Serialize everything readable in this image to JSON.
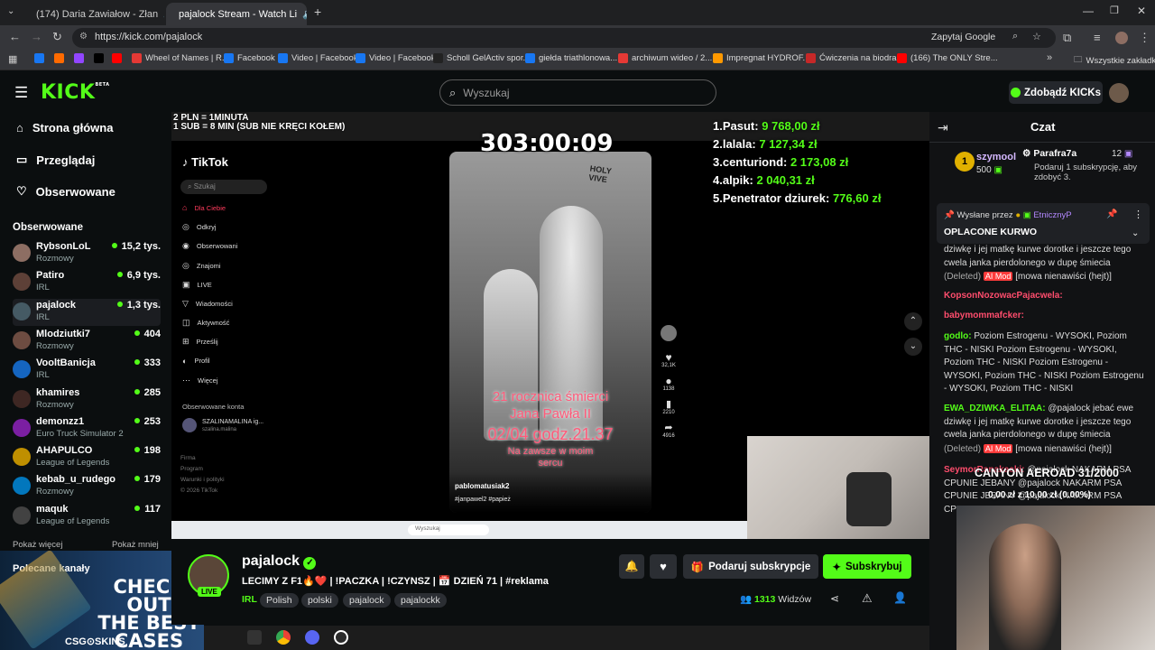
{
  "browser": {
    "tabs": [
      {
        "title": "(174) Daria Zawiałow - Złan",
        "fav_color": "#ff0000"
      },
      {
        "title": "pajalock Stream - Watch Li",
        "fav_color": "#53fc18"
      }
    ],
    "url": "https://kick.com/pajalock",
    "zapytaj": "Zapytaj Google",
    "bookmarks": [
      {
        "label": "",
        "color": "#1877f2"
      },
      {
        "label": "",
        "color": "#ff6a00"
      },
      {
        "label": "",
        "color": "#9146ff"
      },
      {
        "label": "",
        "color": "#000000"
      },
      {
        "label": "",
        "color": "#ff0000"
      },
      {
        "label": "Wheel of Names | R...",
        "color": "#e53935"
      },
      {
        "label": "Facebook",
        "color": "#1877f2"
      },
      {
        "label": "Video | Facebook",
        "color": "#1877f2"
      },
      {
        "label": "Video | Facebook",
        "color": "#1877f2"
      },
      {
        "label": "Scholl GelActiv spor...",
        "color": "#222222"
      },
      {
        "label": "giełda triathlonowa...",
        "color": "#1877f2"
      },
      {
        "label": "archiwum wideo / 2...",
        "color": "#e53935"
      },
      {
        "label": "Impregnat HYDROF...",
        "color": "#ff9900"
      },
      {
        "label": "Ćwiczenia na biodra...",
        "color": "#c62828"
      },
      {
        "label": "(166) The ONLY Stre...",
        "color": "#ff0000"
      }
    ],
    "all_bookmarks": "Wszystkie zakładki"
  },
  "kick": {
    "logo": "KICK",
    "beta": "BETA",
    "search_placeholder": "Wyszukaj",
    "get_kicks": "Zdobądź KICKs",
    "nav": [
      {
        "label": "Strona główna",
        "icon": "home-icon"
      },
      {
        "label": "Przeglądaj",
        "icon": "browse-icon"
      },
      {
        "label": "Obserwowane",
        "icon": "heart-icon"
      }
    ],
    "followed_header": "Obserwowane",
    "channels": [
      {
        "name": "RybsonLoL",
        "category": "Rozmowy",
        "viewers": "15,2 tys.",
        "color": "#8d6e63"
      },
      {
        "name": "Patiro",
        "category": "IRL",
        "viewers": "6,9 tys.",
        "color": "#5d4037"
      },
      {
        "name": "pajalock",
        "category": "IRL",
        "viewers": "1,3 tys.",
        "color": "#455a64"
      },
      {
        "name": "Mlodziutki7",
        "category": "Rozmowy",
        "viewers": "404",
        "color": "#6d4c41"
      },
      {
        "name": "VooltBanicja",
        "category": "IRL",
        "viewers": "333",
        "color": "#1565c0"
      },
      {
        "name": "khamires",
        "category": "Rozmowy",
        "viewers": "285",
        "color": "#3e2723"
      },
      {
        "name": "demonzz1",
        "category": "Euro Truck Simulator 2",
        "viewers": "253",
        "color": "#7b1fa2"
      },
      {
        "name": "AHAPULCO",
        "category": "League of Legends",
        "viewers": "198",
        "color": "#bf8f00"
      },
      {
        "name": "kebab_u_rudego",
        "category": "Rozmowy",
        "viewers": "179",
        "color": "#0277bd"
      },
      {
        "name": "maquk",
        "category": "League of Legends",
        "viewers": "117",
        "color": "#424242"
      }
    ],
    "show_more": "Pokaż więcej",
    "show_less": "Pokaż mniej",
    "recommended": "Polecane kanały"
  },
  "overlay": {
    "pln_line1": "2 PLN = 1MINUTA",
    "pln_line2": "1 SUB = 8 MIN (SUB NIE KRĘCI KOŁEM)",
    "timer": "303:00:09",
    "leaderboard": [
      {
        "rank": "1.",
        "name": "Pasut:",
        "amount": "9 768,00 zł"
      },
      {
        "rank": "2.",
        "name": "lalala:",
        "amount": "7 127,34 zł"
      },
      {
        "rank": "3.",
        "name": "centuriond:",
        "amount": "2 173,08 zł"
      },
      {
        "rank": "4.",
        "name": "alpik:",
        "amount": "2 040,31 zł"
      },
      {
        "rank": "5.",
        "name": "Penetrator dziurek:",
        "amount": "776,60 zł"
      }
    ],
    "goal": "CANYON AEROAD 31/2000",
    "goal_progress": "0,00 zł z 10,00 zł (0.00%)"
  },
  "tiktok": {
    "logo": "TikTok",
    "search": "Szukaj",
    "menu": [
      "Dla Ciebie",
      "Odkryj",
      "Obserwowani",
      "Znajomi",
      "LIVE",
      "Wiadomości",
      "Aktywność",
      "Prześlij",
      "Profil",
      "Więcej"
    ],
    "followed_accounts": "Obserwowane konta",
    "account_name": "SZALINAMALINA ig...",
    "account_sub": "szalina.malina",
    "footer": [
      "Firma",
      "Program",
      "Warunki i polityki",
      "© 2026 TikTok"
    ],
    "caption_line1": "21 rocznica śmierci",
    "caption_line2": "Jana Pawła II",
    "caption_date": "02/04 godz.21.37",
    "caption_forever": "Na zawsze w moim",
    "caption_heart": "sercu",
    "author": "pablomatusiak2",
    "hashtags": "#janpawel2 #papież",
    "likes": "32,1K",
    "comments": "1138",
    "saves": "2210",
    "shares": "4916",
    "video_sign": "HOLY\nVIVE"
  },
  "stream": {
    "streamer": "pajalock",
    "live_badge": "LIVE",
    "title": "LECIMY Z F1🔥❤️ | !PACZKA | !CZYNSZ | 📅 DZIEŃ 71 | #reklama",
    "category": "IRL",
    "tags": [
      "Polish",
      "polski",
      "pajalock",
      "pajalockk"
    ],
    "gift_sub": "Podaruj subskrypcje",
    "subscribe": "Subskrybuj",
    "viewers": "1313",
    "viewers_label": "Widzów"
  },
  "chat": {
    "title": "Czat",
    "top_gifter": {
      "name": "szymool",
      "count": "500"
    },
    "gift_info": {
      "name": "Parafra7a",
      "count": "12",
      "text": "Podaruj 1 subskrypcję, aby zdobyć 3."
    },
    "pinned": {
      "by_label": "Wysłane przez",
      "by_user": "EtnicznyP",
      "text": "OPLACONE KURWO"
    },
    "messages": [
      {
        "user": "",
        "text": "dziwkę i jej matkę kurwe dorotke i jeszcze tego cwela janka pierdolonego w dupę śmiecia",
        "deleted": "(Deleted)",
        "mod": "AI Mod",
        "reason": "[mowa nienawiści (hejt)]"
      },
      {
        "user": "KopsonNozowacPajacwela:",
        "text": "",
        "color": "#ff4d6d"
      },
      {
        "user": "babymommafcker:",
        "text": "",
        "color": "#ff4d6d"
      },
      {
        "user": "godlo:",
        "text": "Poziom Estrogenu - WYSOKI, Poziom THC - NISKI  Poziom Estrogenu - WYSOKI, Poziom THC - NISKI  Poziom Estrogenu - WYSOKI, Poziom THC - NISKI  Poziom Estrogenu - WYSOKI, Poziom THC - NISKI",
        "color": "#53fc18"
      },
      {
        "user": "EWA_DZIWKA_ELITAA:",
        "text": "@pajalock jebać ewe dziwkę i jej matkę kurwe dorotke i jeszcze tego cwela janka pierdolonego w dupę śmiecia",
        "deleted": "(Deleted)",
        "mod": "AI Mod",
        "reason": "[mowa nienawiści (hejt)]",
        "color": "#53fc18"
      },
      {
        "user": "SeymorRanakacki:",
        "text": "@pajalock NAKARM PSA CPUNIE JEBANY @pajalock NAKARM PSA CPUNIE JEBANY @pajalock NAKARM PSA CPUNIE JEBANY",
        "color": "#ff4d6d"
      }
    ]
  },
  "ad": {
    "line1": "CHECK OUT",
    "line2": "THE BEST",
    "line3": "CASES",
    "brand": "CSG⊙SKINS"
  },
  "taskbar_search": "Wyszukaj"
}
